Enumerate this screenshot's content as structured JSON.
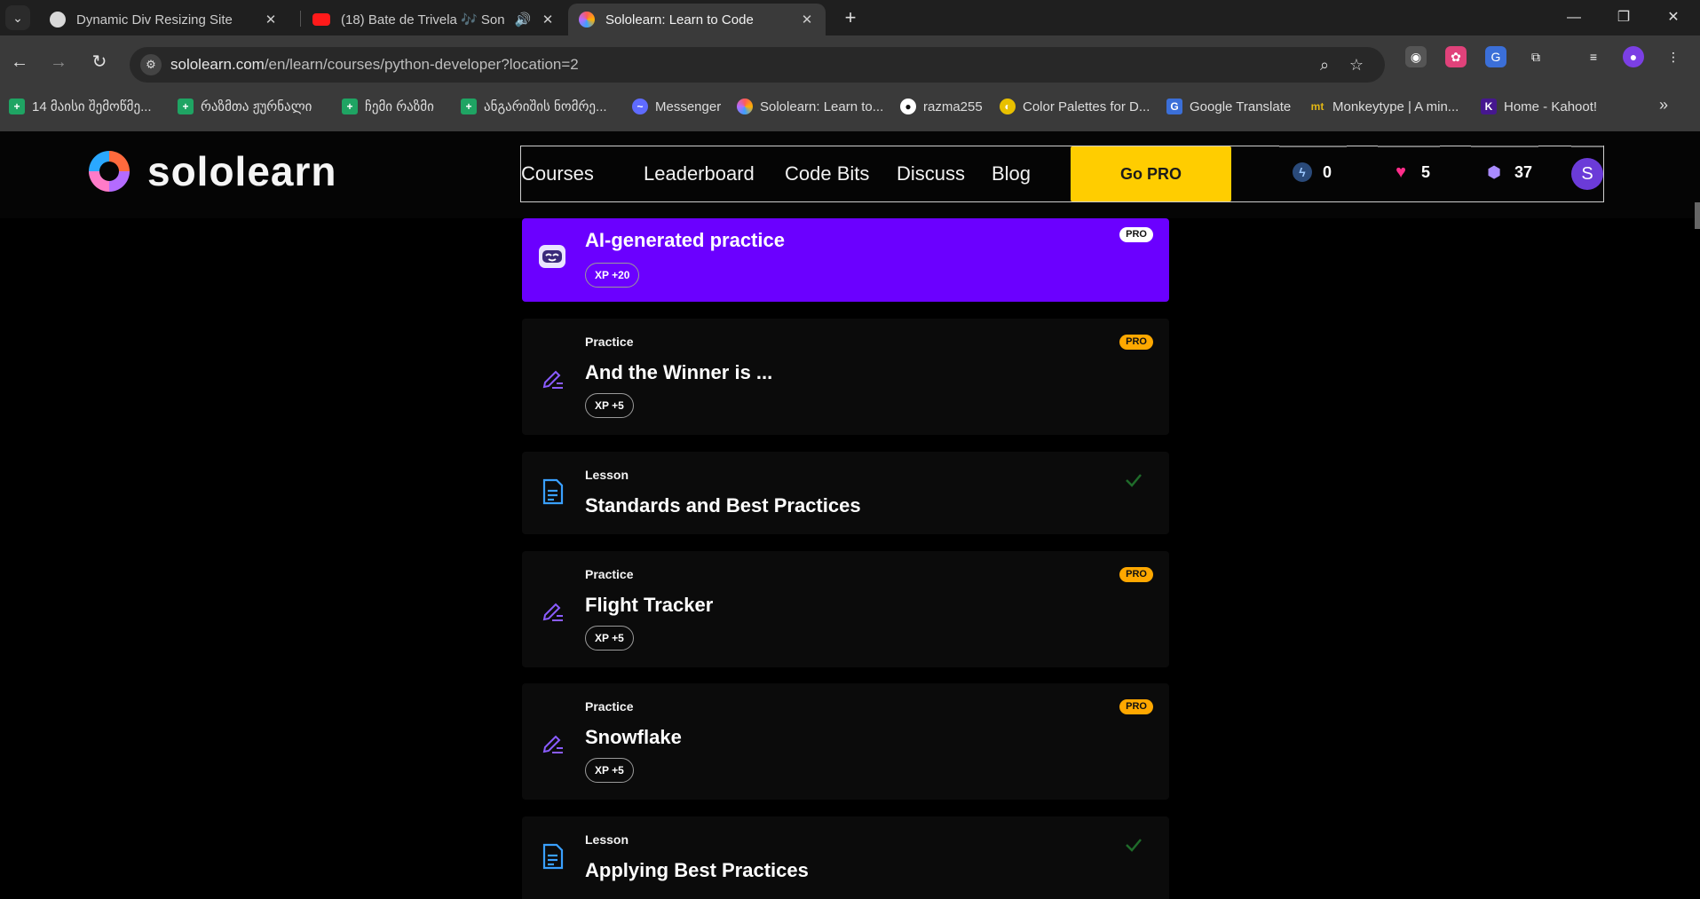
{
  "browser": {
    "tabs": [
      {
        "title": "Dynamic Div Resizing Site",
        "favicon": "openai-icon",
        "close": "✕"
      },
      {
        "title": "(18) Bate de Trivela 🎶 Son",
        "favicon": "youtube-icon",
        "audio": "🔊",
        "close": "✕"
      },
      {
        "title": "Sololearn: Learn to Code",
        "favicon": "sololearn-icon",
        "close": "✕"
      }
    ],
    "new_tab": "+",
    "window_controls": {
      "minimize": "—",
      "restore": "❐",
      "close": "✕"
    },
    "nav": {
      "back": "←",
      "forward": "→",
      "reload": "↻"
    },
    "url_host": "sololearn.com",
    "url_path": "/en/learn/courses/python-developer?location=2",
    "bookmarks": [
      {
        "label": "14 მაისი შემოწმე...",
        "icon": "sheets-icon"
      },
      {
        "label": "რაზმთა ჟურნალი",
        "icon": "sheets-icon"
      },
      {
        "label": "ჩემი რაზმი",
        "icon": "sheets-icon"
      },
      {
        "label": "ანგარიშის ნომრე...",
        "icon": "sheets-icon"
      },
      {
        "label": "Messenger",
        "icon": "messenger-icon"
      },
      {
        "label": "Sololearn: Learn to...",
        "icon": "sololearn-icon"
      },
      {
        "label": "razma255",
        "icon": "github-icon"
      },
      {
        "label": "Color Palettes for D...",
        "icon": "palette-icon"
      },
      {
        "label": "Google Translate",
        "icon": "translate-icon"
      },
      {
        "label": "Monkeytype | A min...",
        "icon": "monkeytype-icon"
      },
      {
        "label": "Home - Kahoot!",
        "icon": "kahoot-icon"
      }
    ],
    "bookmarks_more": "»"
  },
  "site": {
    "logo_text": "sololearn",
    "nav": [
      "Courses",
      "Leaderboard",
      "Code Bits",
      "Discuss",
      "Blog"
    ],
    "go_pro": "Go PRO",
    "streak": "0",
    "hearts": "5",
    "bits": "37",
    "avatar_letter": "S"
  },
  "cards": [
    {
      "type": "ai",
      "kind": "",
      "title": "AI-generated practice",
      "xp": "XP +20",
      "pro": "PRO",
      "done": false
    },
    {
      "type": "practice",
      "kind": "Practice",
      "title": "And the Winner is ...",
      "xp": "XP +5",
      "pro": "PRO",
      "done": false
    },
    {
      "type": "lesson",
      "kind": "Lesson",
      "title": "Standards and Best Practices",
      "xp": "",
      "pro": "",
      "done": true
    },
    {
      "type": "practice",
      "kind": "Practice",
      "title": "Flight Tracker",
      "xp": "XP +5",
      "pro": "PRO",
      "done": false
    },
    {
      "type": "practice",
      "kind": "Practice",
      "title": "Snowflake",
      "xp": "XP +5",
      "pro": "PRO",
      "done": false
    },
    {
      "type": "lesson",
      "kind": "Lesson",
      "title": "Applying Best Practices",
      "xp": "",
      "pro": "",
      "done": true
    }
  ],
  "colors": {
    "accent_purple": "#6b00ff",
    "go_pro_yellow": "#ffcd00",
    "pro_badge": "#ffa800",
    "lesson_blue": "#3aa0ff",
    "practice_purple": "#8a5cff"
  }
}
